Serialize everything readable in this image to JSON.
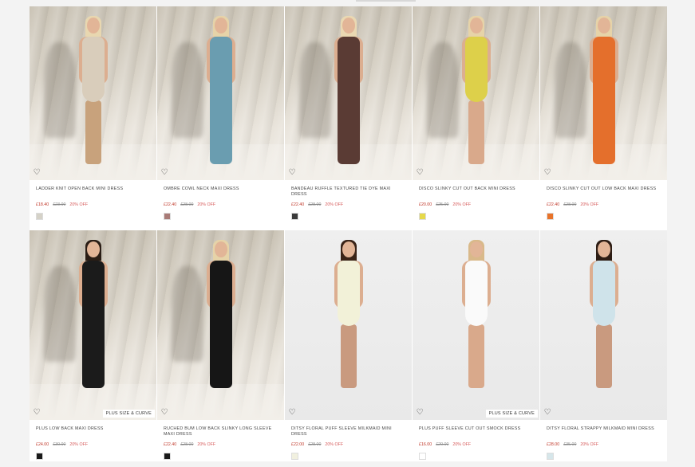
{
  "products": [
    {
      "name": "LADDER KNIT OPEN BACK MINI DRESS",
      "price": "£18.40",
      "was": "£23.00",
      "off": "20% OFF",
      "swatch": "#d5d2c8",
      "badge": "",
      "outfit": "#d9cdbb",
      "legcolor": "#c8a27c",
      "hair": "#e8d7b0",
      "style": "mini",
      "bg": "studio"
    },
    {
      "name": "OMBRE COWL NECK MAXI DRESS",
      "price": "£22.40",
      "was": "£28.00",
      "off": "20% OFF",
      "swatch": "#a97b77",
      "badge": "",
      "outfit": "#6a9db0",
      "legcolor": "#d9a38b",
      "hair": "#e6d3a8",
      "style": "maxi",
      "bg": "studio"
    },
    {
      "name": "BANDEAU RUFFLE TEXTURED TIE DYE MAXI DRESS",
      "price": "£22.40",
      "was": "£28.00",
      "off": "20% OFF",
      "swatch": "#3a3a3a",
      "badge": "",
      "outfit": "#5a3b34",
      "legcolor": "#5a3b34",
      "hair": "#ead8b2",
      "style": "maxi",
      "bg": "studio"
    },
    {
      "name": "DISCO SLINKY CUT OUT BACK MINI DRESS",
      "price": "£20.00",
      "was": "£25.00",
      "off": "20% OFF",
      "swatch": "#e6d94a",
      "badge": "",
      "outfit": "#ddd04a",
      "legcolor": "#d9a98b",
      "hair": "#e6d3a8",
      "style": "mini",
      "bg": "studio"
    },
    {
      "name": "DISCO SLINKY CUT OUT LOW BACK MAXI DRESS",
      "price": "£22.40",
      "was": "£28.00",
      "off": "20% OFF",
      "swatch": "#e8732a",
      "badge": "",
      "outfit": "#e46f2c",
      "legcolor": "#e46f2c",
      "hair": "#e6d3a8",
      "style": "maxi",
      "bg": "studio"
    },
    {
      "name": "PLUS LOW BACK MAXI DRESS",
      "price": "£24.00",
      "was": "£30.00",
      "off": "20% OFF",
      "swatch": "#1a1a1a",
      "badge": "PLUS SIZE & CURVE",
      "outfit": "#1b1b1b",
      "legcolor": "#1b1b1b",
      "hair": "#2a1d15",
      "style": "maxi",
      "bg": "studio"
    },
    {
      "name": "RUCHED BUM LOW BACK SLINKY LONG SLEEVE MAXI DRESS",
      "price": "£22.40",
      "was": "£28.00",
      "off": "20% OFF",
      "swatch": "#1a1a1a",
      "badge": "",
      "outfit": "#161616",
      "legcolor": "#161616",
      "hair": "#e6d3a8",
      "style": "maxi",
      "bg": "studio"
    },
    {
      "name": "DITSY FLORAL PUFF SLEEVE MILKMAID MINI DRESS",
      "price": "£22.00",
      "was": "£28.00",
      "off": "20% OFF",
      "swatch": "#f1f0df",
      "badge": "",
      "outfit": "#f2f1d8",
      "legcolor": "#c99a7f",
      "hair": "#3a2418",
      "style": "mini",
      "bg": "white"
    },
    {
      "name": "PLUS PUFF SLEEVE CUT OUT SMOCK DRESS",
      "price": "£16.00",
      "was": "£20.00",
      "off": "20% OFF",
      "swatch": "#ffffff",
      "badge": "PLUS SIZE & CURVE",
      "outfit": "#fafafa",
      "legcolor": "#d9a98b",
      "hair": "#d9b98a",
      "style": "mini",
      "bg": "white"
    },
    {
      "name": "DITSY FLORAL STRAPPY MILKMAID MINI DRESS",
      "price": "£28.00",
      "was": "£35.00",
      "off": "20% OFF",
      "swatch": "#d6e6ea",
      "badge": "",
      "outfit": "#cfe3ea",
      "legcolor": "#c99a7f",
      "hair": "#2d1d14",
      "style": "mini",
      "bg": "white"
    }
  ],
  "icons": {
    "favorite": "heart-icon"
  }
}
